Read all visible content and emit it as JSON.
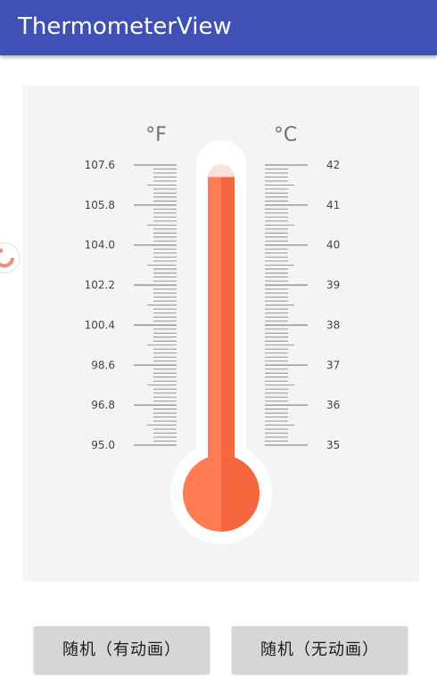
{
  "app": {
    "title": "ThermometerView"
  },
  "thermometer": {
    "fahrenheit_unit": "°F",
    "celsius_unit": "°C",
    "fahrenheit_labels": [
      "107.6",
      "105.8",
      "104.0",
      "102.2",
      "100.4",
      "98.6",
      "96.8",
      "95.0"
    ],
    "celsius_labels": [
      "42",
      "41",
      "40",
      "39",
      "38",
      "37",
      "36",
      "35"
    ],
    "celsius_min": 35,
    "celsius_max": 42,
    "current_celsius": 41.7,
    "mercury_color": "#ff7b52",
    "mercury_dark": "#f4673f",
    "tube_top_color": "#fbe1db",
    "tick_color": "#8a8a8a"
  },
  "buttons": {
    "random_animated": "随机（有动画）",
    "random_static": "随机（无动画）"
  }
}
